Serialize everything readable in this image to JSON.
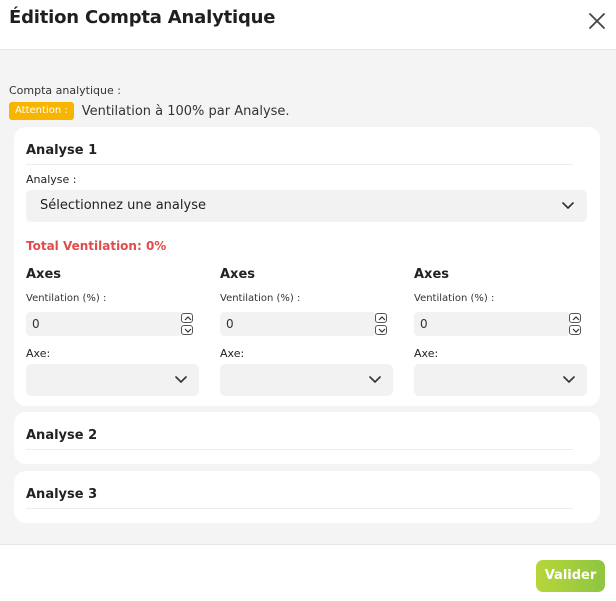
{
  "modal": {
    "title": "Édition Compta Analytique"
  },
  "form": {
    "section_label": "Compta analytique :",
    "notice_badge": "Attention :",
    "notice_text": "Ventilation à 100% par Analyse."
  },
  "analyses": [
    {
      "title": "Analyse 1",
      "analyse_label": "Analyse :",
      "analyse_select_value": "Sélectionnez une analyse",
      "total_label": "Total Ventilation: 0%",
      "axes": [
        {
          "title": "Axes",
          "ventilation_label": "Ventilation (%) :",
          "ventilation_value": "0",
          "axe_label": "Axe:",
          "axe_value": ""
        },
        {
          "title": "Axes",
          "ventilation_label": "Ventilation (%) :",
          "ventilation_value": "0",
          "axe_label": "Axe:",
          "axe_value": ""
        },
        {
          "title": "Axes",
          "ventilation_label": "Ventilation (%) :",
          "ventilation_value": "0",
          "axe_label": "Axe:",
          "axe_value": ""
        }
      ]
    },
    {
      "title": "Analyse 2"
    },
    {
      "title": "Analyse 3"
    }
  ],
  "footer": {
    "validate_label": "Valider"
  },
  "colors": {
    "badge": "#f7b500",
    "total_error": "#e24b4b",
    "validate_start": "#b6d63a",
    "validate_end": "#8fc541"
  },
  "icons": {
    "close": "close-icon",
    "chevron": "chevron-down-icon",
    "spin_up": "chevron-up-icon",
    "spin_down": "chevron-down-icon"
  }
}
